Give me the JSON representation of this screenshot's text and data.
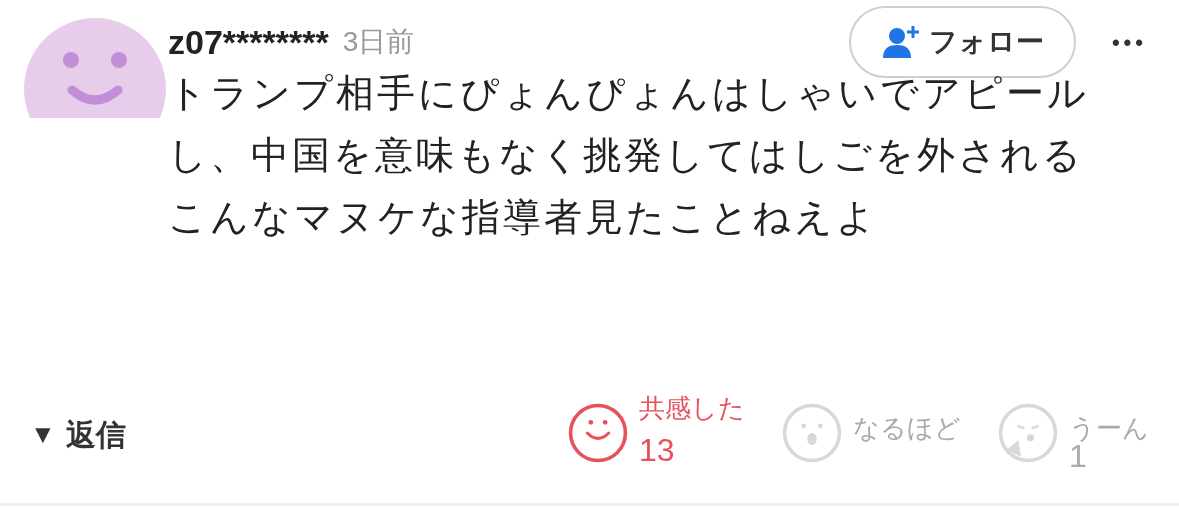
{
  "comment": {
    "user": "z07********",
    "time": "3日前",
    "follow_button": {
      "label": "フォロー"
    },
    "more": "•••",
    "body": [
      "トランプ相手にぴょんぴょんはしゃいでアピールし、中国を意味もなく挑発してはしごを外される",
      "こんなマヌケな指導者見たことねえよ"
    ]
  },
  "reply": {
    "arrow": "▼",
    "label": "返信",
    "expanded": false
  },
  "reactions": [
    {
      "kind": "smile",
      "label": "共感した",
      "count": "13",
      "selected": true
    },
    {
      "kind": "surprise",
      "label": "なるほど",
      "selected": false
    },
    {
      "kind": "hmm",
      "label": "うーん",
      "count": "1",
      "selected": false
    }
  ]
}
